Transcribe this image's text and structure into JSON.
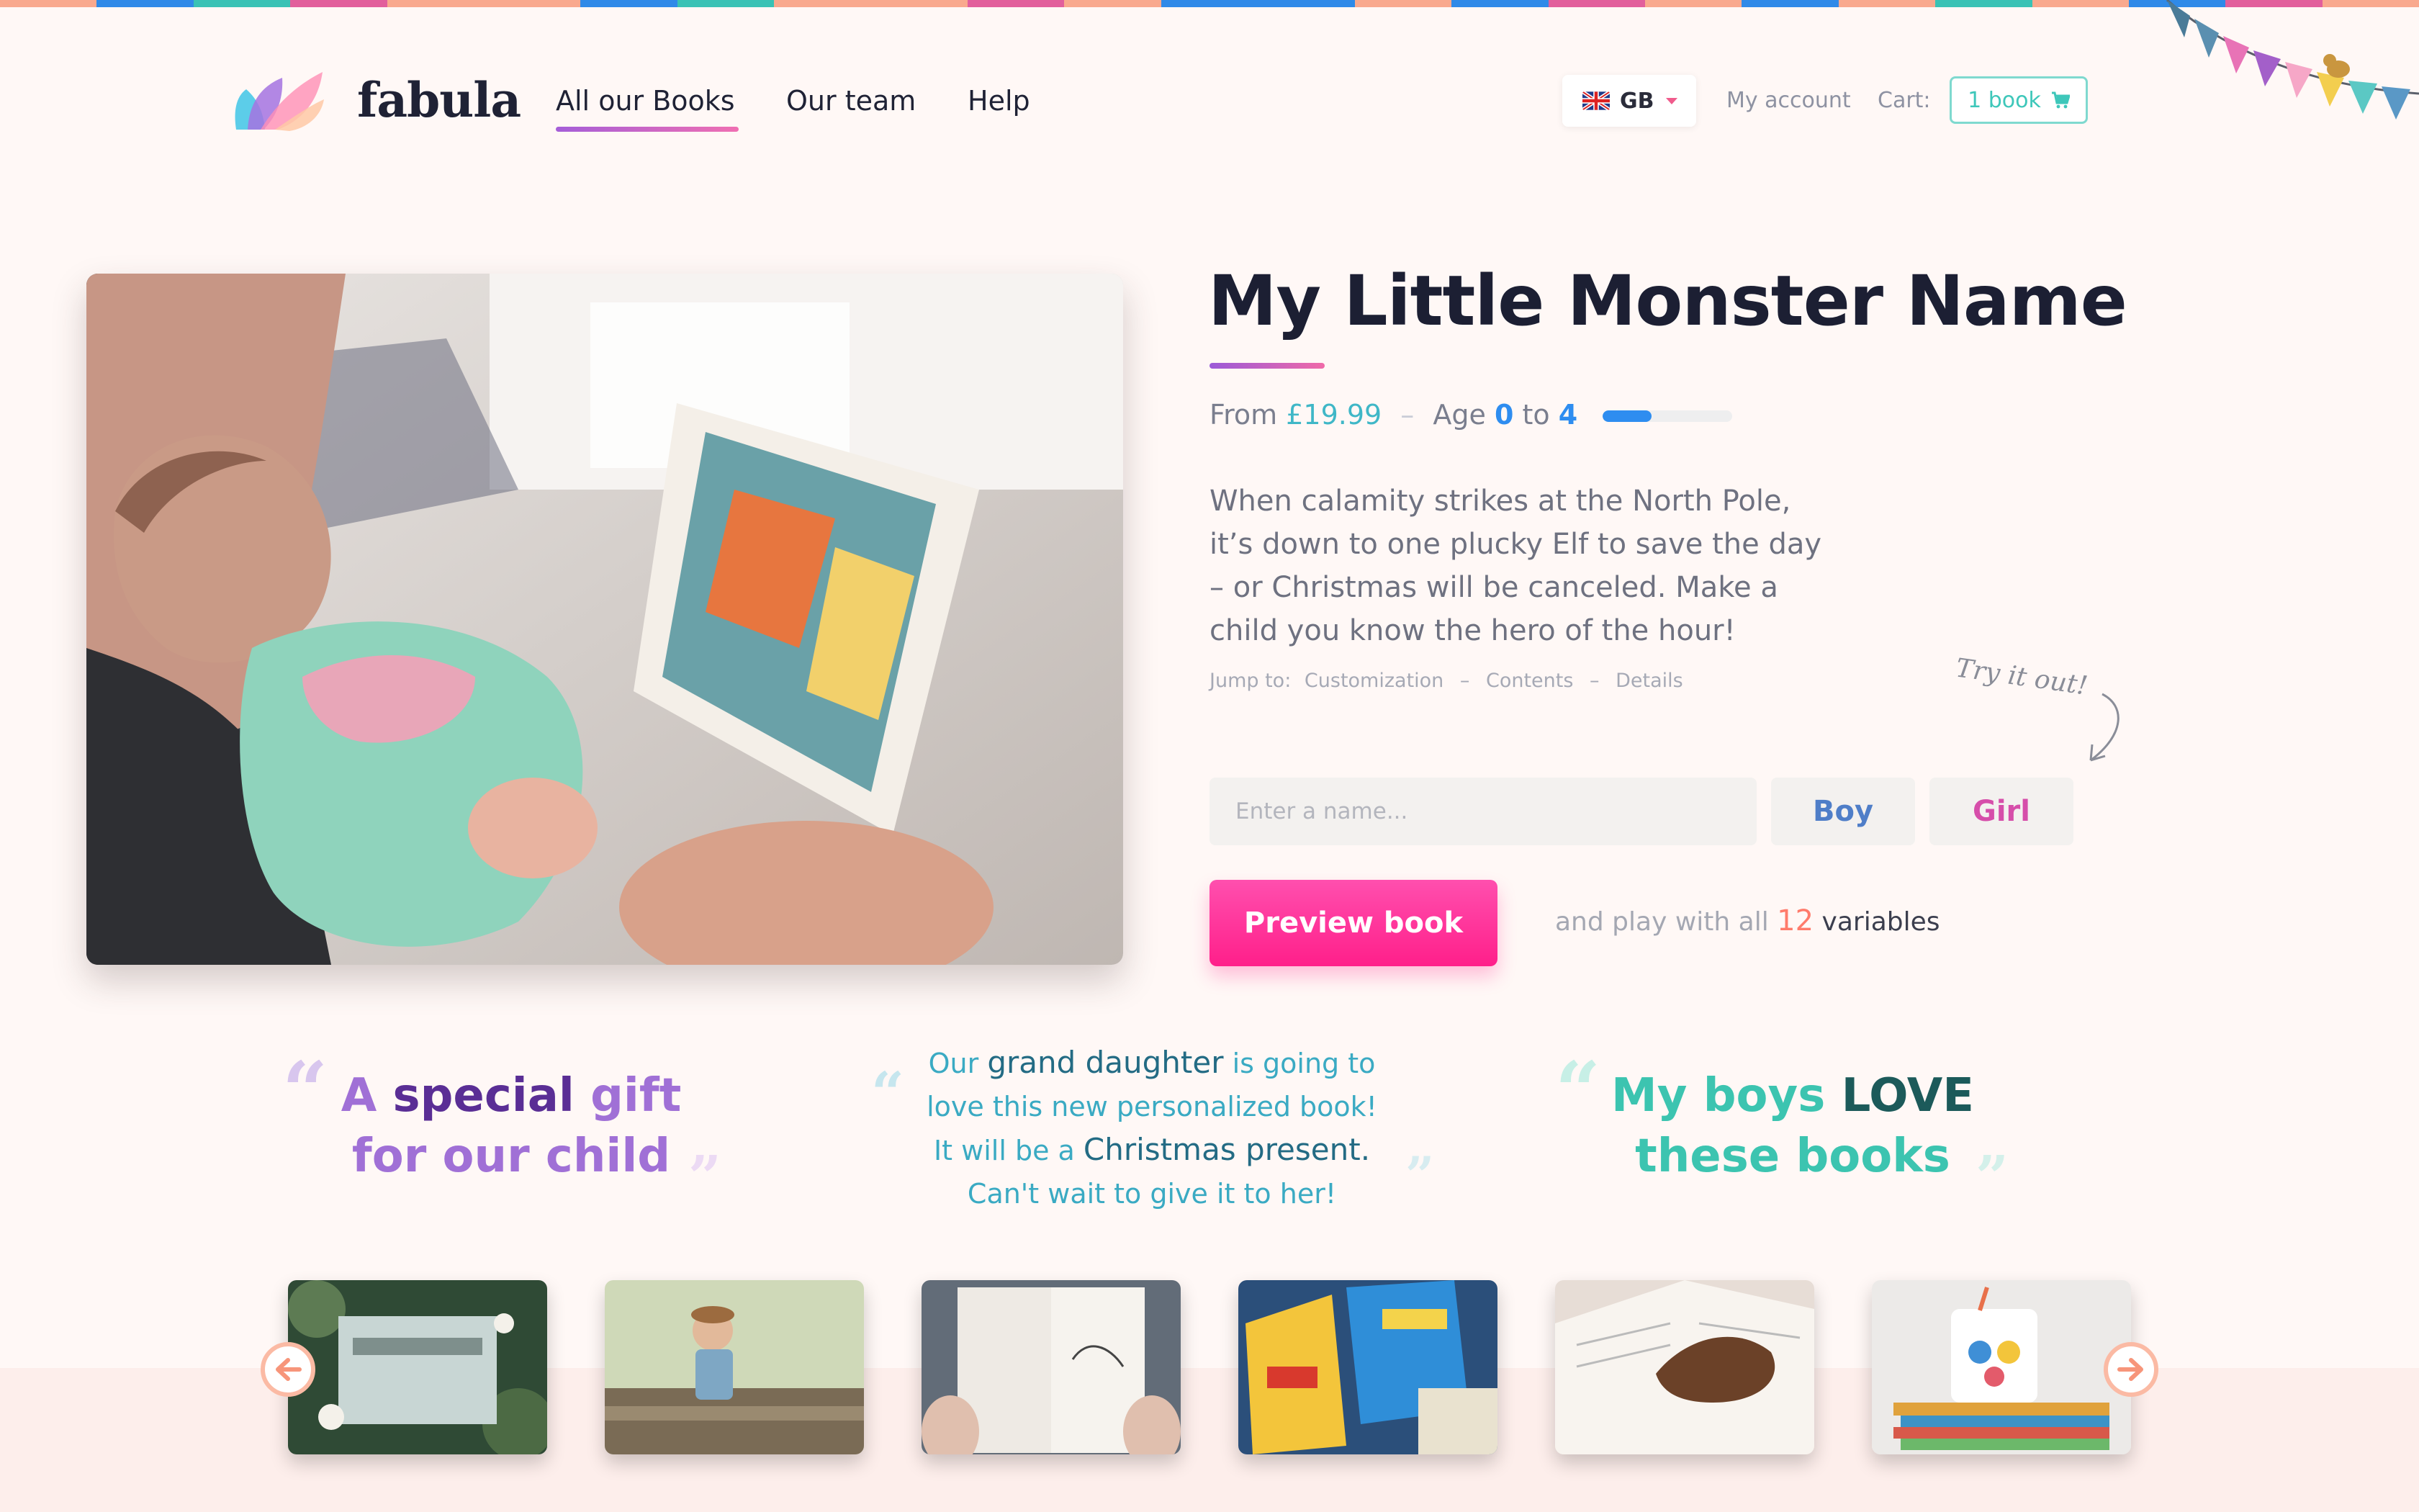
{
  "brand": {
    "name": "fabula"
  },
  "nav": {
    "items": [
      {
        "label": "All our Books"
      },
      {
        "label": "Our team"
      },
      {
        "label": "Help"
      }
    ]
  },
  "header": {
    "language": "GB",
    "account_label": "My account",
    "cart_label": "Cart:",
    "cart_value": "1 book"
  },
  "product": {
    "title": "My Little Monster Name",
    "price_prefix": "From ",
    "price": "£19.99",
    "age_label": "Age",
    "age_min": "0",
    "age_to": "to",
    "age_max": "4",
    "age_level_fraction": 0.38,
    "description": "When calamity strikes at the North Pole, it’s down to one plucky Elf to save the day – or Christmas will be canceled. Make a child you know the hero of the hour!",
    "jump_label": "Jump to:",
    "jump_links": [
      "Customization",
      "Contents",
      "Details"
    ]
  },
  "customize": {
    "try_note": "Try it out!",
    "name_placeholder": "Enter a name...",
    "boy_label": "Boy",
    "girl_label": "Girl",
    "preview_label": "Preview book",
    "vars_prefix": "and play with all",
    "vars_count": "12",
    "vars_suffix": "variables"
  },
  "testimonials": {
    "t1": {
      "a": "A",
      "b": "special",
      "c": "gift",
      "d": "for our child"
    },
    "t2": {
      "a": "Our",
      "b": "grand daughter",
      "c": "is going to",
      "d": "love this new personalized book!",
      "e": "It will be a",
      "f": "Christmas present.",
      "g": "Can't wait to give it to her!"
    },
    "t3": {
      "a": "My boys",
      "b": "LOVE",
      "c": "these books"
    }
  },
  "colors": {
    "accent_pink": "#ff1f8a",
    "accent_teal": "#3ec7ba",
    "accent_blue": "#2e8df0",
    "accent_purple": "#a55ed8"
  },
  "icons": {
    "cart": "cart-icon",
    "flag": "uk-flag-icon",
    "prev": "arrow-left-icon",
    "next": "arrow-right-icon"
  }
}
